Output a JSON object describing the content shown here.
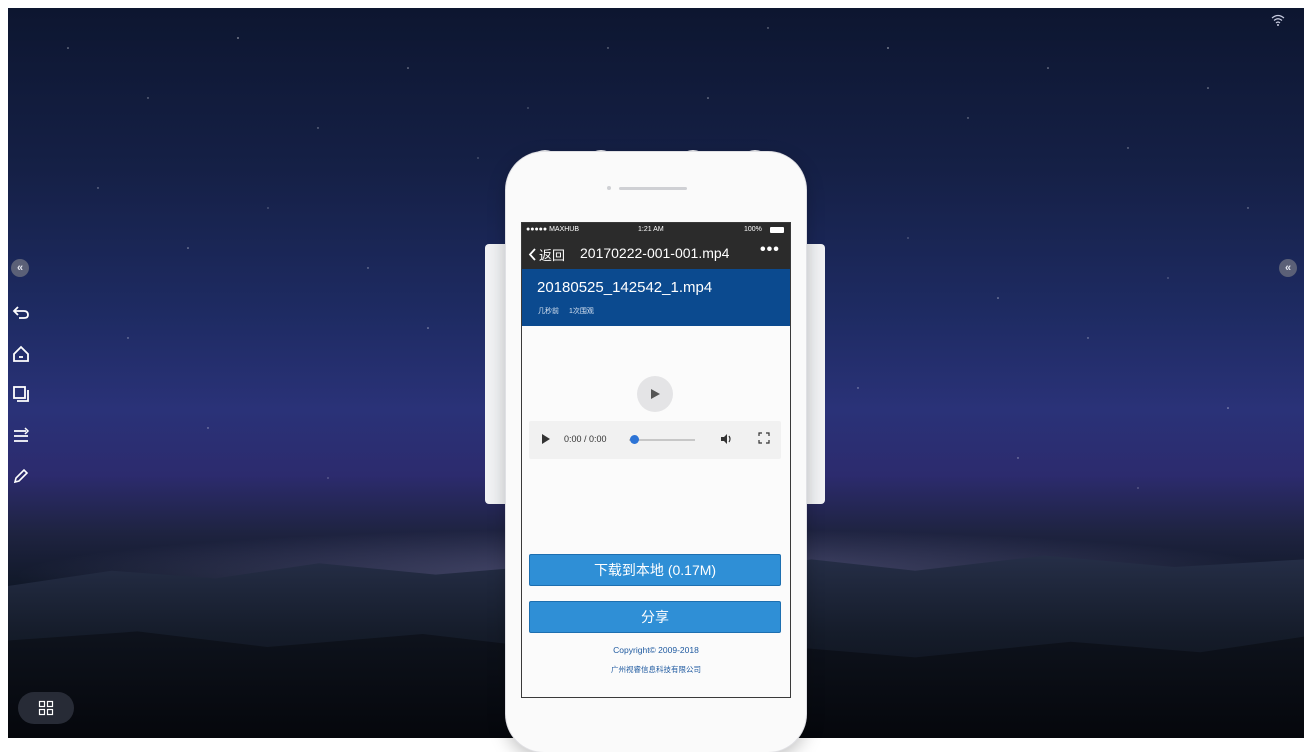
{
  "phone": {
    "status_bar": {
      "carrier": "●●●●● MAXHUB",
      "time": "1:21 AM",
      "battery": "100%"
    },
    "nav": {
      "back_label": "返回",
      "title": "20170222-001-001.mp4",
      "more_label": "•••"
    },
    "file": {
      "name": "20180525_142542_1.mp4",
      "time_ago": "几秒前",
      "views": "1次围观"
    },
    "player": {
      "time": "0:00 / 0:00",
      "progress": 0
    },
    "download_button": "下载到本地 (0.17M)",
    "share_button": "分享",
    "copyright": "Copyright© 2009-2018",
    "company": "广州视睿信息科技有限公司"
  },
  "toolbar": {
    "icons": [
      "collapse-left-icon",
      "back-icon",
      "home-icon",
      "windows-icon",
      "menu-icon",
      "pen-icon"
    ]
  },
  "right_panel": {
    "icon": "collapse-right-icon"
  },
  "system": {
    "wifi_icon": "wifi-icon",
    "apps_icon": "apps-grid-icon"
  },
  "colors": {
    "header_blue": "#0b4a8f",
    "button_blue": "#2f8fd6",
    "dark_bar": "#2b2b2b",
    "progress_blue": "#2d74d6"
  }
}
